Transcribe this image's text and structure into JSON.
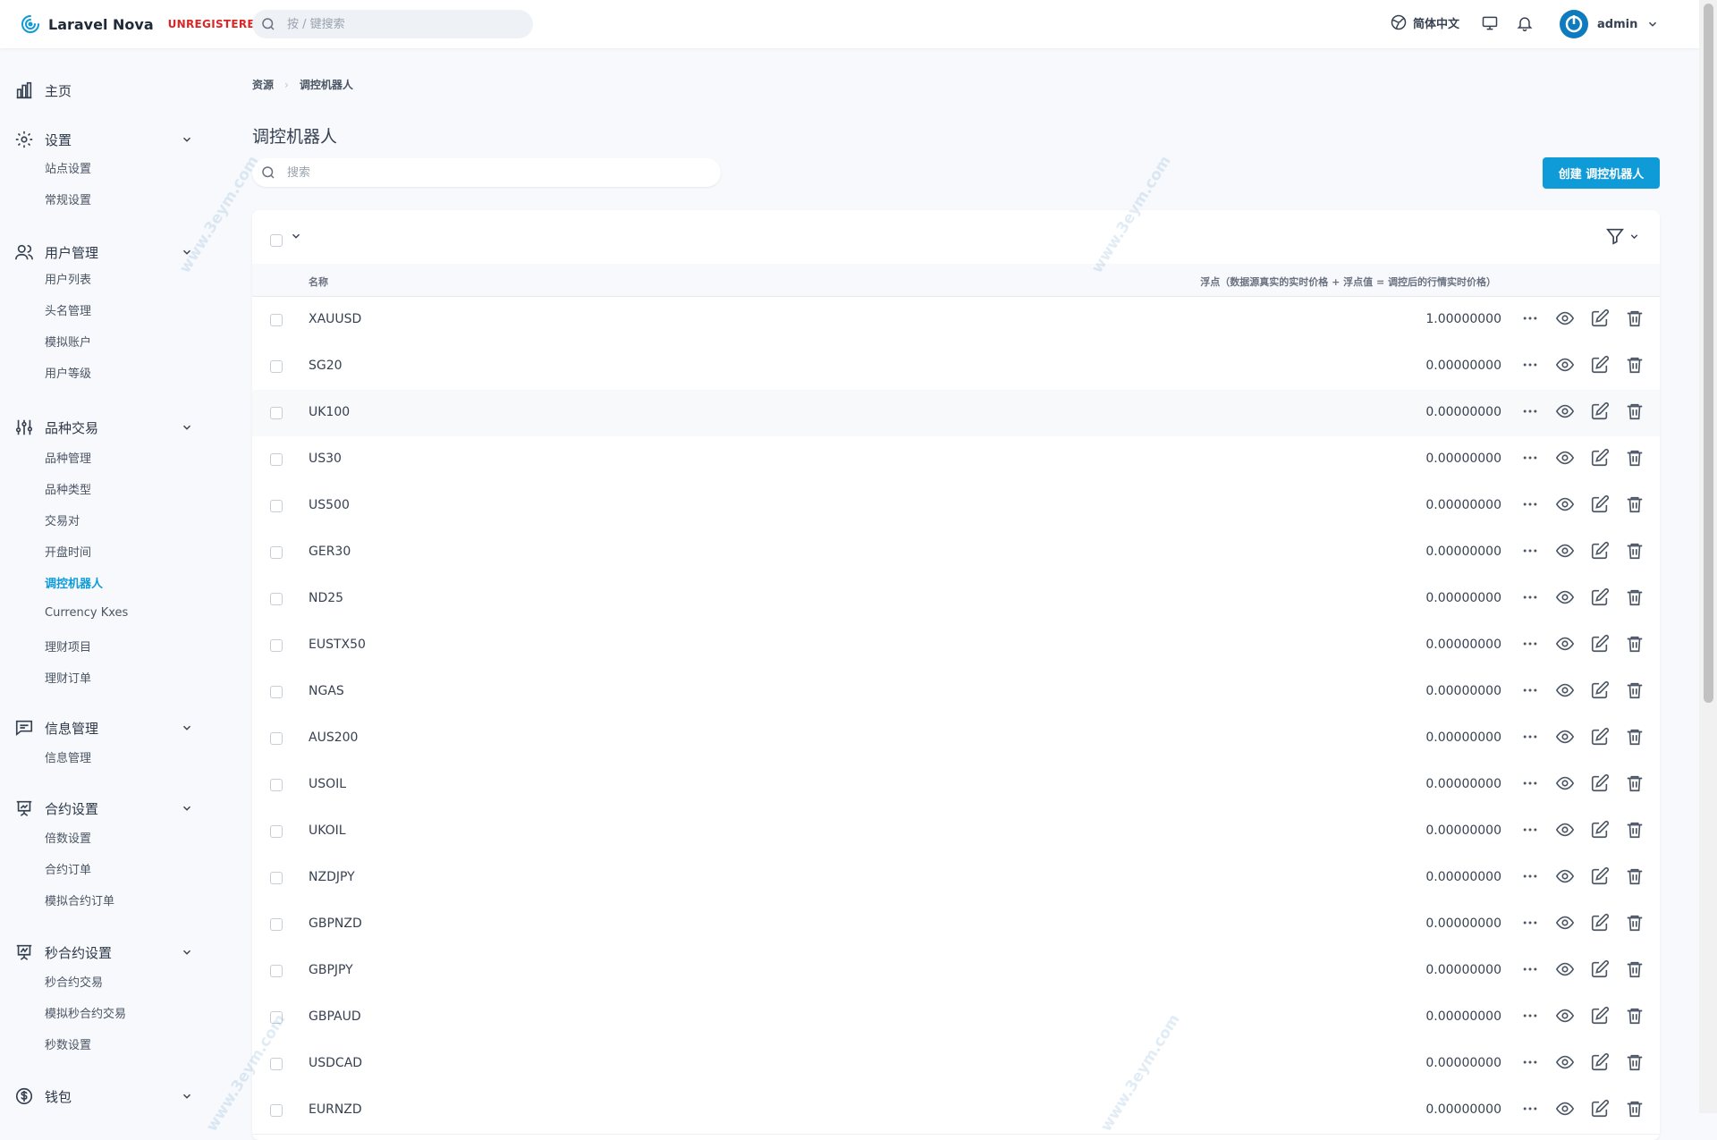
{
  "header": {
    "brand": "Laravel Nova",
    "badge": "UNREGISTERED",
    "search_placeholder": "按 / 键搜索",
    "language": "简体中文",
    "user": "admin"
  },
  "sidebar": {
    "groups": [
      {
        "icon": "chart-bar-icon",
        "label": "主页",
        "items": []
      },
      {
        "icon": "gear-icon",
        "label": "设置",
        "items": [
          "站点设置",
          "常规设置"
        ]
      },
      {
        "icon": "users-icon",
        "label": "用户管理",
        "items": [
          "用户列表",
          "头名管理",
          "模拟账户",
          "用户等级"
        ]
      },
      {
        "icon": "sliders-icon",
        "label": "品种交易",
        "items": [
          "品种管理",
          "品种类型",
          "交易对",
          "开盘时间",
          "调控机器人",
          "Currency Kxes",
          "理财项目",
          "理财订单"
        ]
      },
      {
        "icon": "chat-icon",
        "label": "信息管理",
        "items": [
          "信息管理"
        ]
      },
      {
        "icon": "presentation-chart-icon",
        "label": "合约设置",
        "items": [
          "倍数设置",
          "合约订单",
          "模拟合约订单"
        ]
      },
      {
        "icon": "trend-chart-icon",
        "label": "秒合约设置",
        "items": [
          "秒合约交易",
          "模拟秒合约交易",
          "秒数设置"
        ]
      },
      {
        "icon": "dollar-icon",
        "label": "钱包",
        "items": []
      }
    ],
    "active_item": "调控机器人"
  },
  "breadcrumb": {
    "root": "资源",
    "current": "调控机器人"
  },
  "page": {
    "title": "调控机器人",
    "search_placeholder": "搜索",
    "create_button": "创建 调控机器人"
  },
  "table": {
    "columns": {
      "name": "名称",
      "float": "浮点（数据源真实的实时价格 + 浮点值 = 调控后的行情实时价格）"
    },
    "rows": [
      {
        "name": "XAUUSD",
        "value": "1.00000000"
      },
      {
        "name": "SG20",
        "value": "0.00000000"
      },
      {
        "name": "UK100",
        "value": "0.00000000"
      },
      {
        "name": "US30",
        "value": "0.00000000"
      },
      {
        "name": "US500",
        "value": "0.00000000"
      },
      {
        "name": "GER30",
        "value": "0.00000000"
      },
      {
        "name": "ND25",
        "value": "0.00000000"
      },
      {
        "name": "EUSTX50",
        "value": "0.00000000"
      },
      {
        "name": "NGAS",
        "value": "0.00000000"
      },
      {
        "name": "AUS200",
        "value": "0.00000000"
      },
      {
        "name": "USOIL",
        "value": "0.00000000"
      },
      {
        "name": "UKOIL",
        "value": "0.00000000"
      },
      {
        "name": "NZDJPY",
        "value": "0.00000000"
      },
      {
        "name": "GBPNZD",
        "value": "0.00000000"
      },
      {
        "name": "GBPJPY",
        "value": "0.00000000"
      },
      {
        "name": "GBPAUD",
        "value": "0.00000000"
      },
      {
        "name": "USDCAD",
        "value": "0.00000000"
      },
      {
        "name": "EURNZD",
        "value": "0.00000000"
      }
    ]
  },
  "watermark": "www.3eym.com",
  "colors": {
    "accent": "#0e9bd8",
    "badge": "#dc2626"
  }
}
